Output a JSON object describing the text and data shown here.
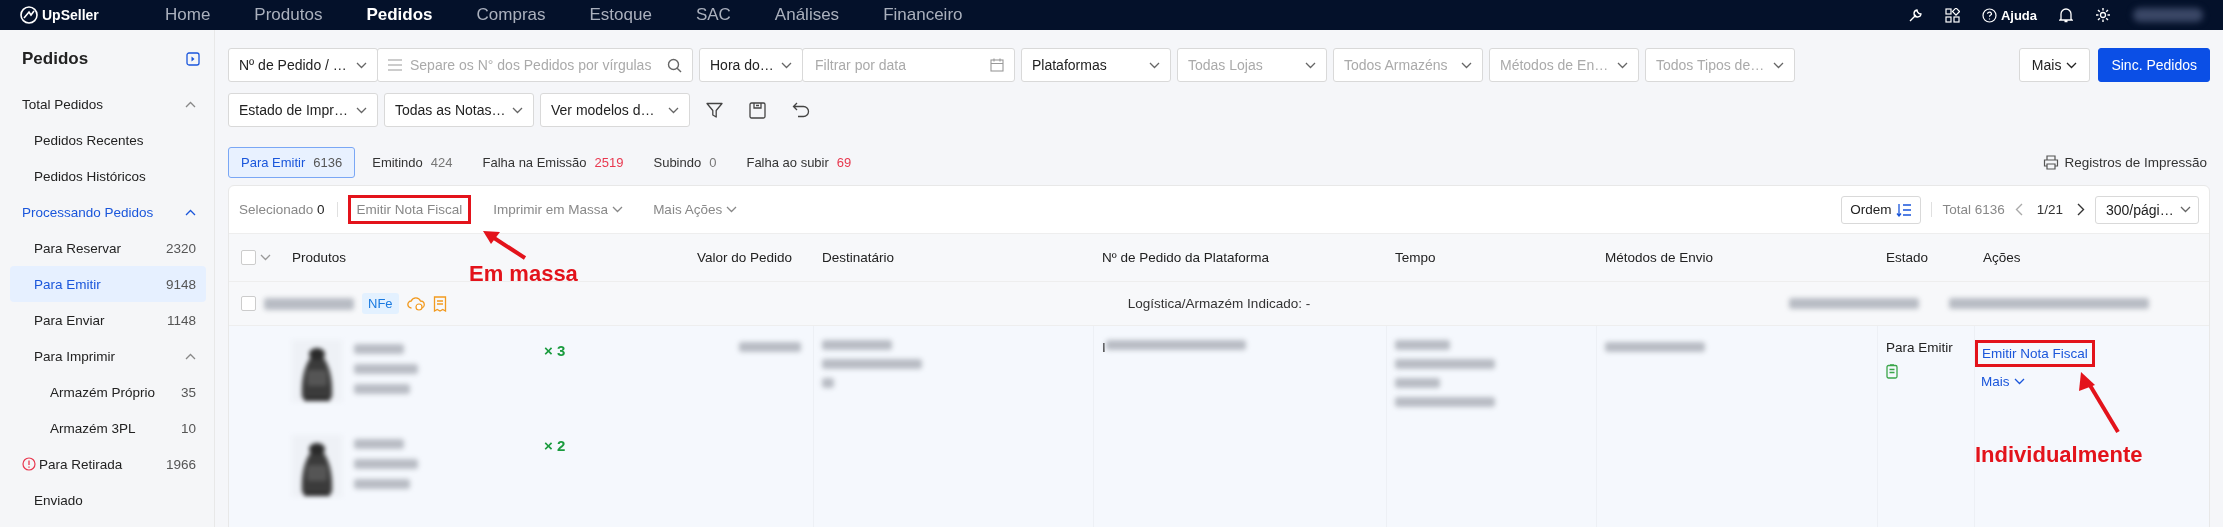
{
  "nav": {
    "brand": "UpSeller",
    "items": [
      {
        "label": "Home",
        "selected": false
      },
      {
        "label": "Produtos",
        "selected": false
      },
      {
        "label": "Pedidos",
        "selected": true
      },
      {
        "label": "Compras",
        "selected": false
      },
      {
        "label": "Estoque",
        "selected": false
      },
      {
        "label": "SAC",
        "selected": false
      },
      {
        "label": "Análises",
        "selected": false
      },
      {
        "label": "Financeiro",
        "selected": false
      }
    ],
    "help": "Ajuda"
  },
  "sidebar": {
    "title": "Pedidos",
    "items": [
      {
        "label": "Total Pedidos",
        "selected": false,
        "expanded": true,
        "children": [
          {
            "label": "Pedidos Recentes",
            "selected": false
          },
          {
            "label": "Pedidos Históricos",
            "selected": false
          }
        ]
      },
      {
        "label": "Processando Pedidos",
        "selected": true,
        "expanded": true,
        "children": [
          {
            "label": "Para Reservar",
            "count": "2320",
            "selected": false
          },
          {
            "label": "Para Emitir",
            "count": "9148",
            "selected": true
          },
          {
            "label": "Para Enviar",
            "count": "1148",
            "selected": false
          },
          {
            "label": "Para Imprimir",
            "selected": false,
            "expanded": true,
            "children": [
              {
                "label": "Armazém Próprio",
                "count": "35",
                "selected": false
              },
              {
                "label": "Armazém 3PL",
                "count": "10",
                "selected": false
              }
            ]
          },
          {
            "label": "Para Retirada",
            "count": "1966",
            "selected": false,
            "warning": true
          },
          {
            "label": "Enviado",
            "selected": false
          }
        ]
      }
    ]
  },
  "filters": {
    "top": {
      "groups": [
        {
          "parts": [
            {
              "kind": "select",
              "value": "Nº de Pedido / …"
            },
            {
              "kind": "search",
              "placeholder": "Separe os N° dos Pedidos por vírgulas"
            }
          ]
        },
        {
          "parts": [
            {
              "kind": "select",
              "value": "Hora do…"
            },
            {
              "kind": "date",
              "placeholder": "Filtrar por data"
            }
          ]
        },
        {
          "parts": [
            {
              "kind": "select",
              "value": "Plataformas"
            }
          ]
        },
        {
          "parts": [
            {
              "kind": "select",
              "placeholder": "Todas Lojas"
            }
          ]
        },
        {
          "parts": [
            {
              "kind": "select",
              "placeholder": "Todos Armazéns"
            }
          ]
        },
        {
          "parts": [
            {
              "kind": "select",
              "placeholder": "Métodos de En…"
            }
          ]
        },
        {
          "parts": [
            {
              "kind": "select",
              "placeholder": "Todos Tipos de…"
            }
          ]
        }
      ]
    },
    "bottom": {
      "groups": [
        {
          "parts": [
            {
              "kind": "select",
              "value": "Estado de Impr…"
            }
          ]
        },
        {
          "parts": [
            {
              "kind": "select",
              "value": "Todas as Notas…"
            }
          ]
        },
        {
          "parts": [
            {
              "kind": "select",
              "value": "Ver modelos d…"
            }
          ]
        },
        {
          "parts": [
            {
              "kind": "filter-icon"
            }
          ]
        },
        {
          "parts": [
            {
              "kind": "save-icon"
            }
          ]
        },
        {
          "parts": [
            {
              "kind": "undo-icon"
            }
          ]
        }
      ]
    },
    "more": "Mais",
    "sync": "Sinc. Pedidos"
  },
  "tabs": [
    {
      "label": "Para Emitir",
      "count": "6136",
      "selected": true,
      "alert": false
    },
    {
      "label": "Emitindo",
      "count": "424",
      "selected": false,
      "alert": false
    },
    {
      "label": "Falha na Emissão",
      "count": "2519",
      "selected": false,
      "alert": true
    },
    {
      "label": "Subindo",
      "count": "0",
      "selected": false,
      "alert": false
    },
    {
      "label": "Falha ao subir",
      "count": "69",
      "selected": false,
      "alert": true
    }
  ],
  "print_log": "Registros de Impressão",
  "toolbar": {
    "selected_label": "Selecionado",
    "selected_count": "0",
    "actions": [
      {
        "label": "Emitir Nota Fiscal",
        "kind": "button",
        "highlighted": true
      },
      {
        "label": "Imprimir em Massa",
        "kind": "dropdown",
        "highlighted": false
      },
      {
        "label": "Mais Ações",
        "kind": "dropdown",
        "highlighted": false
      }
    ],
    "order": "Ordem",
    "total": "Total 6136",
    "page": "1/21",
    "page_size": "300/pági…"
  },
  "table": {
    "all_checked": false,
    "columns": [
      "Produtos",
      "Valor do Pedido",
      "Destinatário",
      "Nº de Pedido da Plataforma",
      "Tempo",
      "Métodos de Envio",
      "Estado",
      "Ações"
    ],
    "group": {
      "checked": false,
      "tag": "NFe",
      "note": "Logística/Armazém Indicado: -"
    },
    "row": {
      "products": [
        {
          "qty": "× 3"
        },
        {
          "qty": "× 2"
        }
      ],
      "order_prefix": "I",
      "status": "Para Emitir",
      "actions": [
        {
          "label": "Emitir Nota Fiscal",
          "kind": "link",
          "highlighted": true
        },
        {
          "label": "Mais",
          "kind": "dropdown",
          "highlighted": false
        }
      ]
    }
  },
  "annotations": {
    "bulk": "Em massa",
    "single": "Individualmente"
  }
}
